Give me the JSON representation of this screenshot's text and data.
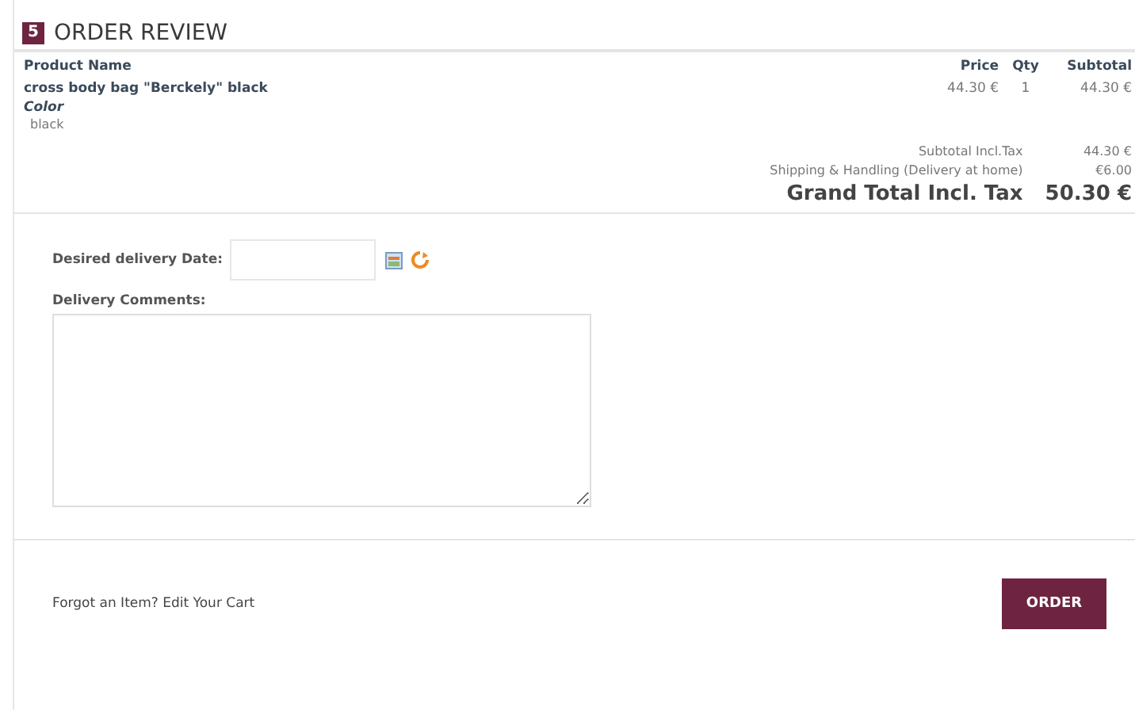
{
  "header": {
    "step": "5",
    "title": "ORDER REVIEW"
  },
  "table": {
    "columns": [
      "Product Name",
      "Price",
      "Qty",
      "Subtotal"
    ],
    "rows": [
      {
        "name": "cross body bag \"Berckely\" black",
        "price": "44.30 €",
        "qty": "1",
        "subtotal": "44.30 €",
        "options": [
          {
            "label": "Color",
            "value": "black"
          }
        ]
      }
    ]
  },
  "totals": [
    {
      "kind": "normal",
      "label": "Subtotal Incl.Tax",
      "value": "44.30 €"
    },
    {
      "kind": "normal",
      "label": "Shipping & Handling (Delivery at home)",
      "value": "€6.00"
    },
    {
      "kind": "grand",
      "label": "Grand Total Incl. Tax",
      "value": "50.30 €"
    }
  ],
  "form": {
    "date_label": "Desired delivery Date:",
    "comments_label": "Delivery Comments:"
  },
  "footer": {
    "text": "Forgot an Item?",
    "link": "Edit Your Cart",
    "button": "ORDER"
  }
}
